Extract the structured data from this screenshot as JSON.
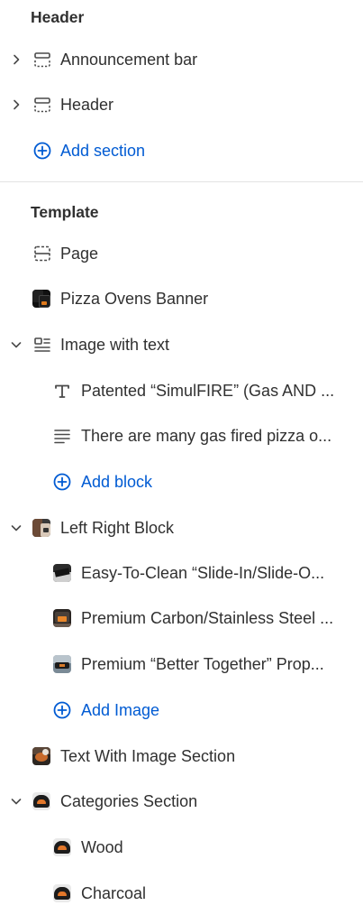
{
  "header_group": {
    "title": "Header",
    "items": [
      {
        "label": "Announcement bar"
      },
      {
        "label": "Header"
      }
    ],
    "add_label": "Add section"
  },
  "template_group": {
    "title": "Template",
    "page_label": "Page",
    "pizza_banner_label": "Pizza Ovens Banner",
    "image_with_text": {
      "label": "Image with text",
      "blocks": [
        {
          "label": "Patented “SimulFIRE” (Gas AND ..."
        },
        {
          "label": "There are many gas fired pizza o..."
        }
      ],
      "add_label": "Add block"
    },
    "left_right_block": {
      "label": "Left Right Block",
      "blocks": [
        {
          "label": "Easy-To-Clean “Slide-In/Slide-O..."
        },
        {
          "label": "Premium Carbon/Stainless Steel ..."
        },
        {
          "label": "Premium “Better Together” Prop..."
        }
      ],
      "add_label": "Add Image"
    },
    "text_with_image_label": "Text With Image Section",
    "categories": {
      "label": "Categories Section",
      "blocks": [
        {
          "label": "Wood"
        },
        {
          "label": "Charcoal"
        }
      ]
    }
  },
  "colors": {
    "text": "#303030",
    "accent": "#005bd3",
    "icon": "#4a4a4a",
    "divider": "#e3e3e3"
  }
}
